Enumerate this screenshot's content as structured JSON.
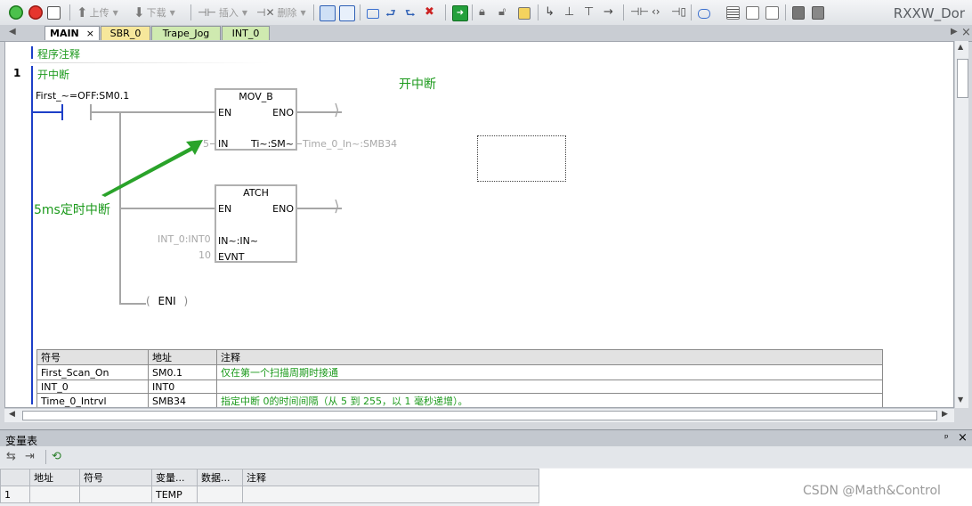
{
  "toolbar": {
    "upload_label": "上传",
    "download_label": "下载",
    "insert_label": "插入",
    "delete_label": "删除",
    "app_title": "RXXW_Dor"
  },
  "tabs": [
    {
      "label": "MAIN"
    },
    {
      "label": "SBR_0"
    },
    {
      "label": "Trape_Jog"
    },
    {
      "label": "INT_0"
    }
  ],
  "program_comment_label": "程序注释",
  "network": {
    "number": "1",
    "title": "开中断",
    "comment_floating": "开中断",
    "annotation_label": "5ms定时中断",
    "contact": {
      "symbol": "First_~=OFF:SM0.1"
    },
    "mov_b": {
      "title": "MOV_B",
      "en": "EN",
      "eno": "ENO",
      "in_pin": "IN",
      "out_pin": "Ti~:SM~",
      "in_value": "5",
      "out_value": "Time_0_In~:SMB34"
    },
    "atch": {
      "title": "ATCH",
      "en": "EN",
      "eno": "ENO",
      "int_pin": "IN~:IN~",
      "evnt_pin": "EVNT",
      "int_value": "INT_0:INT0",
      "evnt_value": "10"
    },
    "eni_label": "ENI"
  },
  "symbol_table": {
    "headers": [
      "符号",
      "地址",
      "注释"
    ],
    "rows": [
      {
        "symbol": "First_Scan_On",
        "address": "SM0.1",
        "comment": "仅在第一个扫描周期时接通"
      },
      {
        "symbol": "INT_0",
        "address": "INT0",
        "comment": ""
      },
      {
        "symbol": "Time_0_Intrvl",
        "address": "SMB34",
        "comment": "指定中断 0的时间间隔（从 5 到 255，以 1 毫秒递增）。"
      }
    ]
  },
  "var_table": {
    "title": "变量表",
    "headers": [
      "地址",
      "符号",
      "变量...",
      "数据...",
      "注释"
    ],
    "rows": [
      {
        "num": "1",
        "address": "",
        "symbol": "",
        "var_type": "TEMP",
        "data_type": "",
        "comment": ""
      }
    ]
  },
  "watermark": "CSDN @Math&Control",
  "colors": {
    "accent_blue": "#1d3fc8",
    "comment_green": "#1c9a1c",
    "arrow_green": "#2aa32a",
    "tab_yellow": "#f6e79b",
    "tab_green": "#cfeab0"
  }
}
